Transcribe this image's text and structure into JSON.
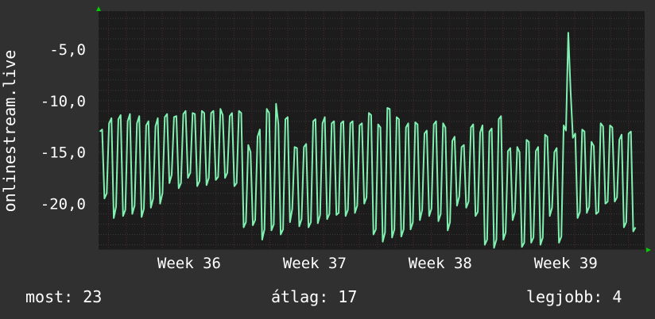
{
  "chart_data": {
    "type": "line",
    "ylabel": "onlinestream.live",
    "ylim": [
      -24.5,
      -1.3
    ],
    "ytick_labels": [
      "-5,0",
      "-10,0",
      "-15,0",
      "-20,0"
    ],
    "yticks": [
      -5,
      -10,
      -15,
      -20
    ],
    "xtick_labels": [
      "Week 36",
      "Week 37",
      "Week 38",
      "Week 39"
    ],
    "xticks": [
      36,
      37,
      38,
      39
    ],
    "xlim": [
      35.35,
      39.7
    ],
    "grid": true,
    "colors": {
      "line": "#80f0b0",
      "background": "#1c1c1c",
      "grid": "#502828",
      "axis_arrow": "#00d000"
    },
    "series": [
      {
        "cycle_days": 1,
        "samples_per_day": 5,
        "first_day": 35.36,
        "days": 30,
        "values": [
          -13,
          -12.8,
          -19.5,
          -19,
          -12.2,
          -11.7,
          -21.4,
          -20.3,
          -11.8,
          -11.4,
          -21.2,
          -20.6,
          -12,
          -11.3,
          -21,
          -20.2,
          -12.2,
          -11.5,
          -21.3,
          -20.5,
          -12.4,
          -12,
          -20.4,
          -19.5,
          -12.5,
          -11.7,
          -20,
          -19,
          -11.6,
          -11.3,
          -18,
          -17.2,
          -11.6,
          -11.5,
          -18.5,
          -18,
          -11.3,
          -11,
          -17.5,
          -17,
          -11.2,
          -11.3,
          -18.3,
          -17.8,
          -11,
          -11.2,
          -18.2,
          -17.5,
          -11.2,
          -11,
          -17.7,
          -17.4,
          -10.8,
          -11.4,
          -17.5,
          -17,
          -11.5,
          -11.2,
          -18.3,
          -18,
          -11,
          -11.2,
          -22.3,
          -21.8,
          -14.3,
          -15,
          -22.1,
          -21.6,
          -13.5,
          -12.8,
          -23.5,
          -22.5,
          -10.8,
          -11.2,
          -22.6,
          -22,
          -10.3,
          -12.3,
          -23,
          -22.5,
          -11.8,
          -11.6,
          -21.8,
          -20.5,
          -14.5,
          -14.6,
          -22.2,
          -21.5,
          -14.5,
          -14.2,
          -22.3,
          -21.8,
          -12,
          -11.8,
          -21.9,
          -21.1,
          -12.2,
          -11.6,
          -21.5,
          -21,
          -12.2,
          -12,
          -21.1,
          -20.9,
          -12.2,
          -12,
          -21.2,
          -20.6,
          -12.2,
          -12,
          -20.9,
          -20.2,
          -12.4,
          -12.2,
          -20,
          -19.4,
          -11.2,
          -11.4,
          -23,
          -22.5,
          -12.3,
          -12.6,
          -23.7,
          -22.8,
          -10.7,
          -10.8,
          -23.3,
          -22.5,
          -11.6,
          -11.8,
          -23.2,
          -22.5,
          -12.6,
          -12.2,
          -22.5,
          -21.8,
          -12.1,
          -12.3,
          -21.6,
          -20.6,
          -13.2,
          -12.9,
          -21.2,
          -20.5,
          -12.3,
          -12,
          -21.7,
          -21,
          -12.2,
          -12.6,
          -22.6,
          -21.8,
          -13.9,
          -13.5,
          -20.2,
          -19.3,
          -14.5,
          -14.3,
          -20.4,
          -19.8,
          -12.6,
          -12.3,
          -21.2,
          -20.8,
          -13.1,
          -12.4,
          -24,
          -23.5,
          -13,
          -12.7,
          -24.3,
          -23.5,
          -11.8,
          -11.5,
          -23.5,
          -22.8,
          -14.9,
          -14.6,
          -21.6,
          -20.8,
          -14.5,
          -15,
          -24.2,
          -23.8,
          -13.8,
          -14,
          -23.8,
          -23.3,
          -14.9,
          -14.5,
          -24,
          -23.3,
          -13.3,
          -13.5,
          -21.2,
          -20.4,
          -15,
          -14.6,
          -23.8,
          -23.2,
          -12.4,
          -12.9,
          -3.4,
          -9,
          -13.6,
          -13.2,
          -21.4,
          -20.8,
          -12.8,
          -13,
          -20.9,
          -20.3,
          -14,
          -14.4,
          -21,
          -20.8,
          -12.2,
          -12.5,
          -20,
          -19.8,
          -12.4,
          -12.6,
          -19.8,
          -19.4,
          -13.8,
          -13.3,
          -22.3,
          -21.8,
          -13.2,
          -13,
          -22.7,
          -22.3
        ]
      }
    ]
  },
  "footer": {
    "most": "most: 23",
    "avg": "átlag: 17",
    "best": "legjobb: 4"
  }
}
